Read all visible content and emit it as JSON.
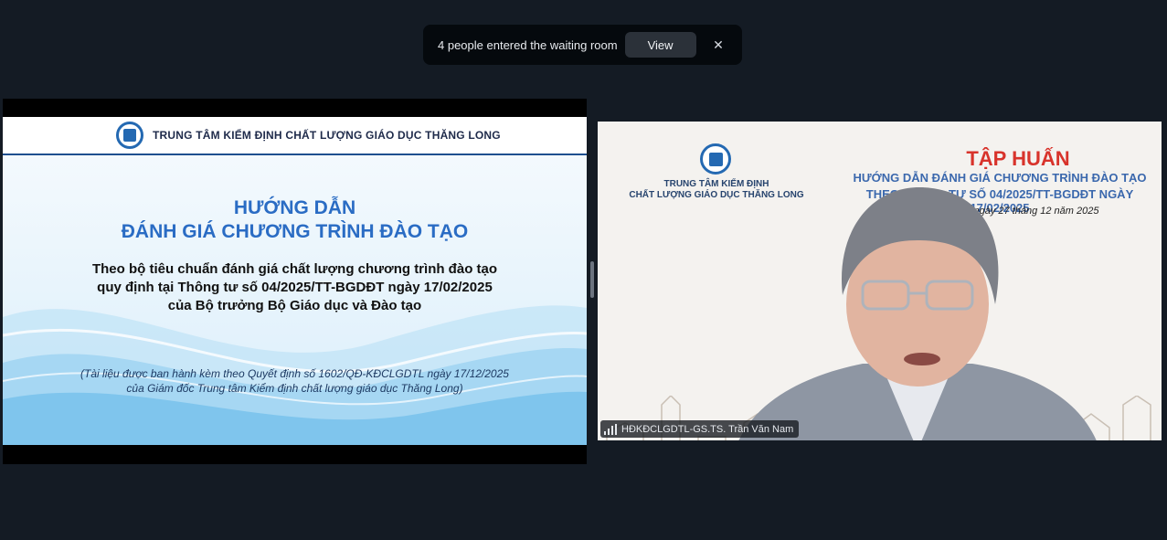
{
  "notification": {
    "message": "4 people entered the waiting room",
    "view_label": "View",
    "close_icon": "close-icon"
  },
  "shared_slide": {
    "organization": "TRUNG TÂM KIỂM ĐỊNH CHẤT LƯỢNG GIÁO DỤC THĂNG LONG",
    "title_line1": "HƯỚNG DẪN",
    "title_line2": "ĐÁNH GIÁ CHƯƠNG TRÌNH ĐÀO TẠO",
    "subtitle_line1": "Theo bộ tiêu chuẩn đánh giá chất lượng chương trình đào tạo",
    "subtitle_line2": "quy định tại Thông tư số 04/2025/TT-BGDĐT ngày 17/02/2025",
    "subtitle_line3": "của Bộ trưởng Bộ Giáo dục và Đào tạo",
    "note_line1": "(Tài liệu được ban hành kèm theo Quyết định số 1602/QĐ-KĐCLGDTL ngày 17/12/2025",
    "note_line2": "của Giám đốc Trung tâm Kiểm định chất lượng giáo dục Thăng Long)"
  },
  "video_tile": {
    "banner_org_line1": "TRUNG TÂM KIỂM ĐỊNH",
    "banner_org_line2": "CHẤT LƯỢNG GIÁO DỤC THĂNG LONG",
    "banner_title": "TẬP HUẤN",
    "banner_sub_line1": "HƯỚNG DẪN ĐÁNH GIÁ CHƯƠNG TRÌNH ĐÀO TẠO",
    "banner_sub_line2": "THEO THÔNG TƯ SỐ 04/2025/TT-BGDĐT NGÀY 17/02/2025",
    "banner_date": "ngày 27 tháng 12 năm 2025",
    "participant_name": "HĐKĐCLGDTL-GS.TS. Trần Văn Nam"
  },
  "colors": {
    "background": "#141b24",
    "slide_title": "#2a6cc4",
    "banner_title": "#d8332b"
  }
}
